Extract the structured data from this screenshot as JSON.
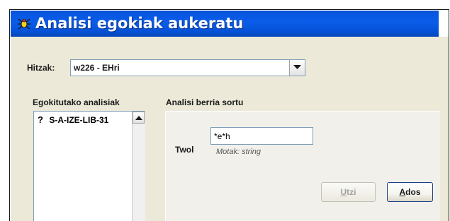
{
  "dialog": {
    "title": "Analisi egokiak aukeratu",
    "icon": "bug-icon"
  },
  "hitzak": {
    "label": "Hitzak:",
    "selected": "w226 - EHri"
  },
  "egokitutako": {
    "label": "Egokitutako analisiak",
    "items": [
      {
        "marker": "?",
        "text": "S-A-IZE-LIB-31"
      }
    ]
  },
  "analisi_berria": {
    "label": "Analisi berria sortu",
    "twol_label": "Twol",
    "twol_value": "*e*h",
    "hint": "Motak: string"
  },
  "buttons": {
    "utzi": {
      "mnemonic": "U",
      "rest": "tzi",
      "enabled": false
    },
    "ados": {
      "mnemonic": "A",
      "rest": "dos",
      "enabled": true
    }
  },
  "colors": {
    "title_bar": "#0a5ce8",
    "panel_bg": "#ece9d8"
  }
}
